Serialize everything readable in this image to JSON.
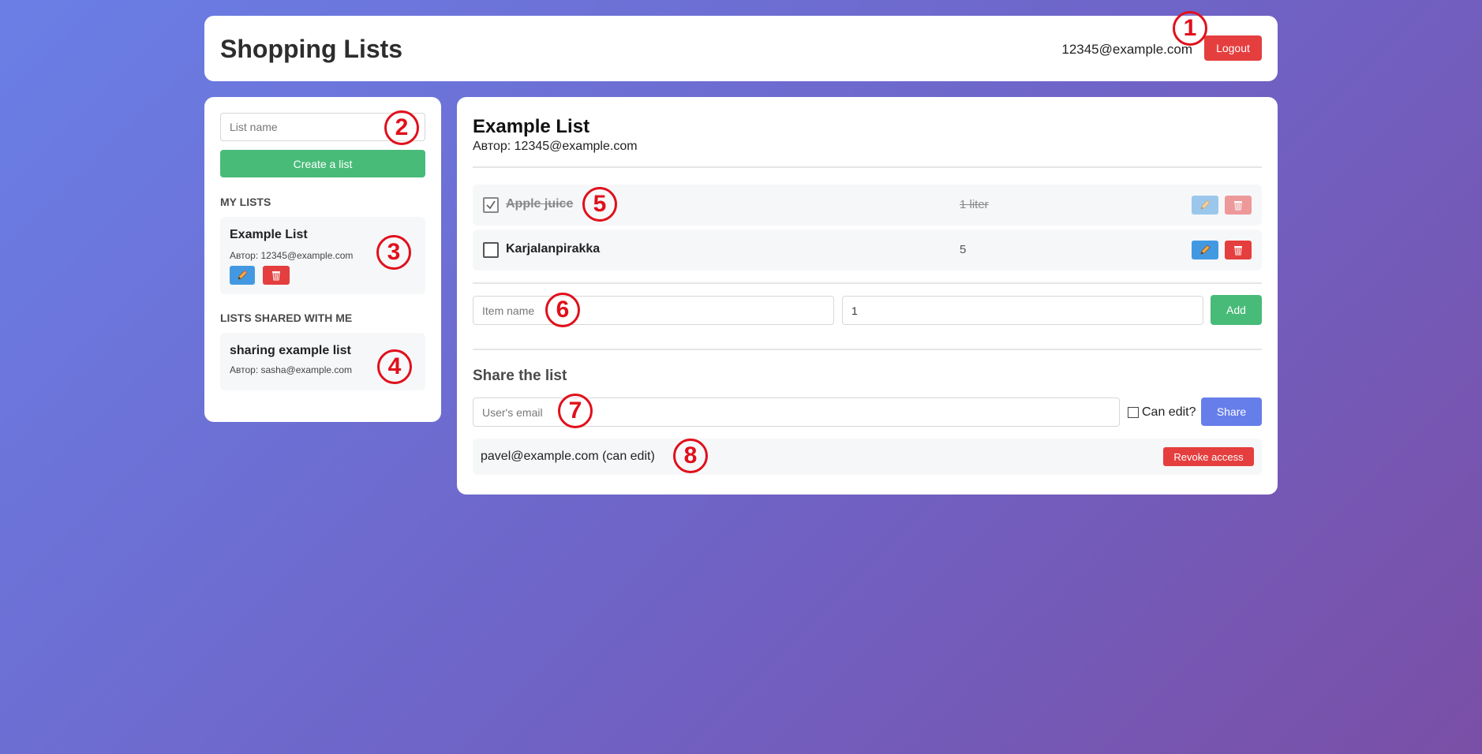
{
  "header": {
    "title": "Shopping Lists",
    "user_email": "12345@example.com",
    "logout_label": "Logout"
  },
  "sidebar": {
    "list_name_placeholder": "List name",
    "create_button_label": "Create a list",
    "my_lists_title": "MY LISTS",
    "my_lists": [
      {
        "name": "Example List",
        "author": "Автор: 12345@example.com"
      }
    ],
    "shared_title": "LISTS SHARED WITH ME",
    "shared_lists": [
      {
        "name": "sharing example list",
        "author": "Автор: sasha@example.com"
      }
    ]
  },
  "main": {
    "list_title": "Example List",
    "list_author": "Автор: 12345@example.com",
    "items": [
      {
        "name": "Apple juice",
        "quantity": "1 liter",
        "checked": true
      },
      {
        "name": "Karjalanpirakka",
        "quantity": "5",
        "checked": false
      }
    ],
    "item_name_placeholder": "Item name",
    "item_quantity_value": "1",
    "add_button_label": "Add",
    "share_title": "Share the list",
    "share_email_placeholder": "User's email",
    "can_edit_label": "Can edit?",
    "share_button_label": "Share",
    "shared_with": [
      {
        "text": "pavel@example.com (can edit)",
        "revoke_label": "Revoke access"
      }
    ]
  },
  "markers": [
    "1",
    "2",
    "3",
    "4",
    "5",
    "6",
    "7",
    "8"
  ],
  "colors": {
    "accent_green": "#48bb78",
    "accent_red": "#e53e3e",
    "accent_blue": "#4299e1",
    "accent_indigo": "#667eea",
    "marker_red": "#e0101b"
  },
  "icons": {
    "edit": "pencil-icon",
    "delete": "trash-icon",
    "check": "checkmark-icon"
  }
}
